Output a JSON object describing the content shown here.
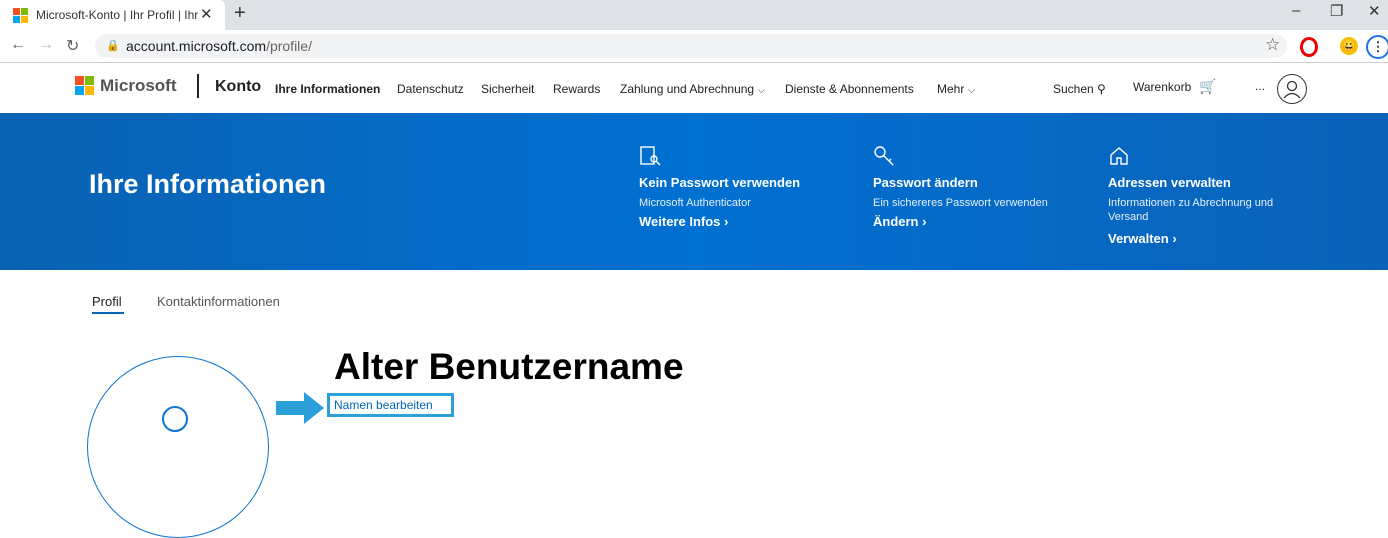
{
  "browser": {
    "tab_title": "Microsoft-Konto | Ihr Profil | Ihre",
    "url_domain": "account.microsoft.com",
    "url_path": "/profile/"
  },
  "header": {
    "logo_text": "Microsoft",
    "konto": "Konto",
    "nav": [
      {
        "label": "Ihre Informationen"
      },
      {
        "label": "Datenschutz"
      },
      {
        "label": "Sicherheit"
      },
      {
        "label": "Rewards"
      },
      {
        "label": "Zahlung und Abrechnung"
      },
      {
        "label": "Dienste & Abonnements"
      },
      {
        "label": "Mehr"
      }
    ],
    "search": "Suchen",
    "cart": "Warenkorb",
    "more_dots": "..."
  },
  "banner": {
    "title": "Ihre Informationen",
    "cards": [
      {
        "title": "Kein Passwort verwenden",
        "subtitle": "Microsoft Authenticator",
        "link": "Weitere Infos"
      },
      {
        "title": "Passwort ändern",
        "subtitle": "Ein sichereres Passwort verwenden",
        "link": "Ändern"
      },
      {
        "title": "Adressen verwalten",
        "subtitle": "Informationen zu Abrechnung und Versand",
        "link": "Verwalten"
      }
    ]
  },
  "subtabs": [
    {
      "label": "Profil"
    },
    {
      "label": "Kontaktinformationen"
    }
  ],
  "profile": {
    "name": "Alter Benutzername",
    "edit_link": "Namen bearbeiten"
  },
  "colors": {
    "accent": "#0067b8",
    "banner": "#0070d1",
    "highlight": "#2b9fd9"
  }
}
